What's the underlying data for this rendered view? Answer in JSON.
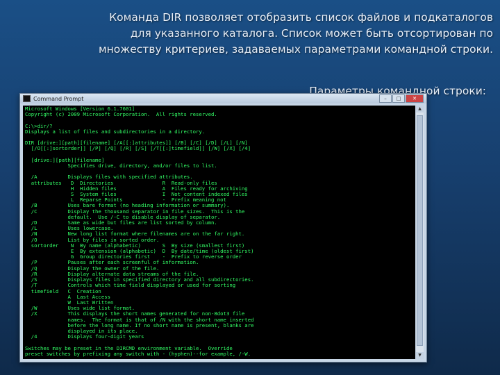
{
  "slide": {
    "title_lines": [
      "Команда DIR позволяет отобразить список файлов и подкаталогов",
      "для указанного каталога. Список может быть отсортирован по",
      "множеству критериев, задаваемых параметрами командной строки."
    ],
    "subtitle": "Параметры командной строки:"
  },
  "window": {
    "title": "Command Prompt",
    "buttons": {
      "minimize": "–",
      "maximize": "□",
      "close": "✕"
    }
  },
  "console_text": "Microsoft Windows [Version 6.1.7601]\nCopyright (c) 2009 Microsoft Corporation.  All rights reserved.\n\nC:\\>dir/?\nDisplays a list of files and subdirectories in a directory.\n\nDIR [drive:][path][filename] [/A[[:]attributes]] [/B] [/C] [/D] [/L] [/N]\n  [/O[[:]sortorder]] [/P] [/Q] [/R] [/S] [/T[[:]timefield]] [/W] [/X] [/4]\n\n  [drive:][path][filename]\n              Specifies drive, directory, and/or files to list.\n\n  /A          Displays files with specified attributes.\n  attributes   D  Directories                R  Read-only files\n               H  Hidden files               A  Files ready for archiving\n               S  System files               I  Not content indexed files\n               L  Reparse Points             -  Prefix meaning not\n  /B          Uses bare format (no heading information or summary).\n  /C          Display the thousand separator in file sizes.  This is the\n              default.  Use /-C to disable display of separator.\n  /D          Same as wide but files are list sorted by column.\n  /L          Uses lowercase.\n  /N          New long list format where filenames are on the far right.\n  /O          List by files in sorted order.\n  sortorder    N  By name (alphabetic)       S  By size (smallest first)\n               E  By extension (alphabetic)  D  By date/time (oldest first)\n               G  Group directories first    -  Prefix to reverse order\n  /P          Pauses after each screenful of information.\n  /Q          Display the owner of the file.\n  /R          Display alternate data streams of the file.\n  /S          Displays files in specified directory and all subdirectories.\n  /T          Controls which time field displayed or used for sorting\n  timefield   C  Creation\n              A  Last Access\n              W  Last Written\n  /W          Uses wide list format.\n  /X          This displays the short names generated for non-8dot3 file\n              names.  The format is that of /N with the short name inserted\n              before the long name. If no short name is present, blanks are\n              displayed in its place.\n  /4          Displays four-digit years\n\nSwitches may be preset in the DIRCMD environment variable.  Override\npreset switches by prefixing any switch with - (hyphen)--for example, /-W.\n\nC:\\>_"
}
